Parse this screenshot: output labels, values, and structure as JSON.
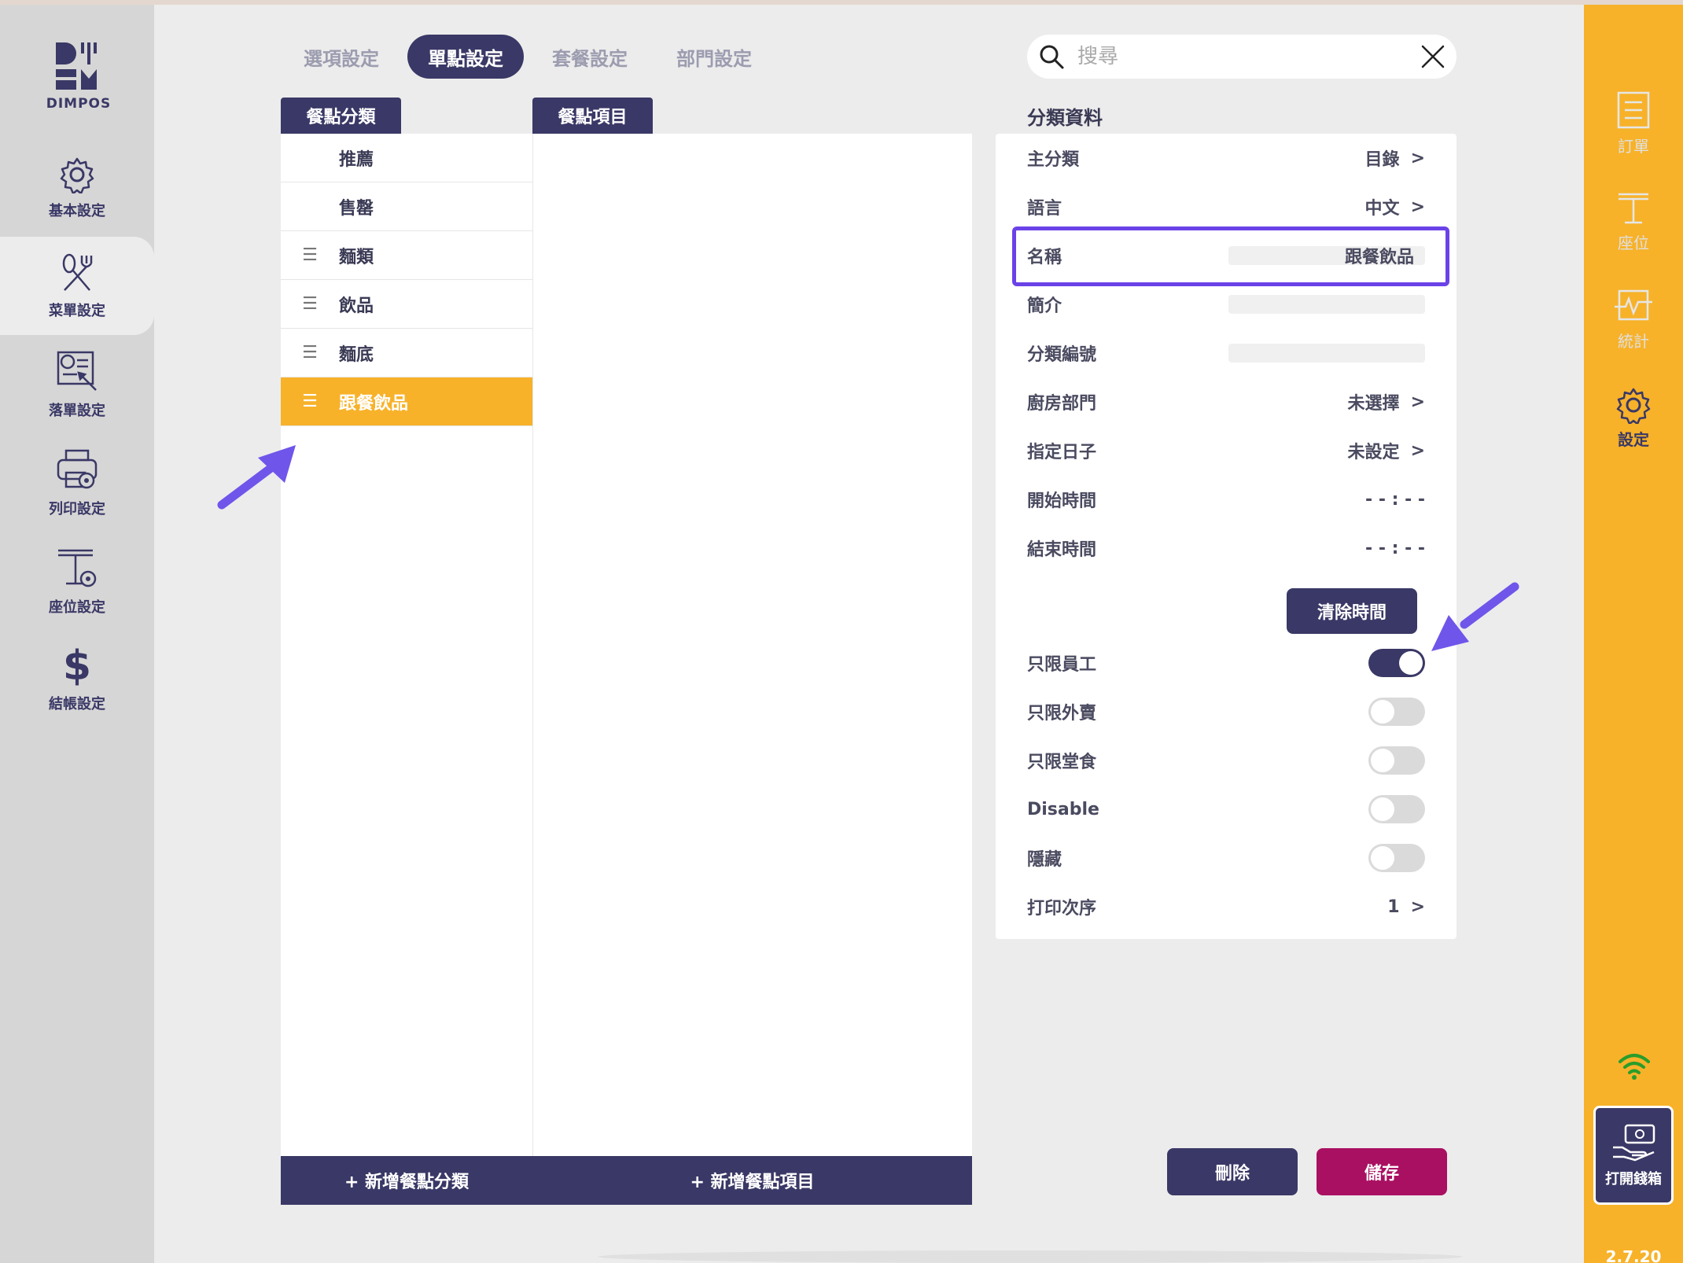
{
  "brand": {
    "logo_text": "DIMPOS"
  },
  "left_nav": [
    {
      "label": "基本設定",
      "icon": "gear-icon"
    },
    {
      "label": "菜單設定",
      "icon": "utensils-icon",
      "active": true
    },
    {
      "label": "落單設定",
      "icon": "order-settings-icon"
    },
    {
      "label": "列印設定",
      "icon": "printer-icon"
    },
    {
      "label": "座位設定",
      "icon": "table-icon"
    },
    {
      "label": "結帳設定",
      "icon": "dollar-icon"
    }
  ],
  "tabs": [
    {
      "label": "選項設定"
    },
    {
      "label": "單點設定",
      "active": true
    },
    {
      "label": "套餐設定"
    },
    {
      "label": "部門設定"
    }
  ],
  "search": {
    "placeholder": "搜尋",
    "value": ""
  },
  "columns": {
    "category_title": "餐點分類",
    "item_title": "餐點項目",
    "add_category": "+ 新增餐點分類",
    "add_item": "+ 新增餐點項目"
  },
  "categories": [
    {
      "label": "推薦",
      "draggable": false
    },
    {
      "label": "售罄",
      "draggable": false
    },
    {
      "label": "麵類",
      "draggable": true
    },
    {
      "label": "飲品",
      "draggable": true
    },
    {
      "label": "麵底",
      "draggable": true
    },
    {
      "label": "跟餐飲品",
      "draggable": true,
      "selected": true
    }
  ],
  "detail": {
    "title": "分類資料",
    "main_category": {
      "label": "主分類",
      "value": "目錄"
    },
    "language": {
      "label": "語言",
      "value": "中文"
    },
    "name": {
      "label": "名稱",
      "value": "跟餐飲品"
    },
    "intro": {
      "label": "簡介",
      "value": ""
    },
    "category_code": {
      "label": "分類編號",
      "value": ""
    },
    "kitchen": {
      "label": "廚房部門",
      "value": "未選擇"
    },
    "day": {
      "label": "指定日子",
      "value": "未設定"
    },
    "start_time": {
      "label": "開始時間",
      "value": "- - : - -"
    },
    "end_time": {
      "label": "結束時間",
      "value": "- - : - -"
    },
    "clear_time": "清除時間",
    "staff_only": {
      "label": "只限員工",
      "on": true
    },
    "takeaway_only": {
      "label": "只限外賣",
      "on": false
    },
    "dinein_only": {
      "label": "只限堂食",
      "on": false
    },
    "disable": {
      "label": "Disable",
      "on": false
    },
    "hidden": {
      "label": "隱藏",
      "on": false
    },
    "print_order": {
      "label": "打印次序",
      "value": "1"
    }
  },
  "actions": {
    "delete": "刪除",
    "save": "儲存"
  },
  "right_nav": [
    {
      "label": "訂單",
      "icon": "receipt-icon"
    },
    {
      "label": "座位",
      "icon": "seat-icon"
    },
    {
      "label": "統計",
      "icon": "stats-icon"
    },
    {
      "label": "設定",
      "icon": "gear-icon",
      "active": true
    }
  ],
  "cashbox": {
    "label": "打開錢箱"
  },
  "version": "2.7.20",
  "colors": {
    "primary": "#3a3866",
    "accent": "#f7b22a",
    "save": "#a91062",
    "highlight": "#6a42e8"
  }
}
